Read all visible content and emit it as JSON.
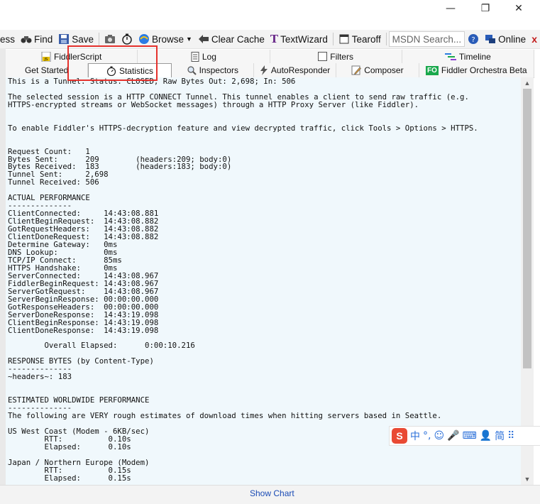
{
  "window": {
    "minimize": "—",
    "restore": "❐",
    "close": "✕"
  },
  "toolbar": {
    "partial_left": "ess",
    "find": "Find",
    "save": "Save",
    "browse": "Browse",
    "clear_cache": "Clear Cache",
    "textwizard": "TextWizard",
    "tearoff": "Tearoff",
    "search_placeholder": "MSDN Search...",
    "online": "Online",
    "close_x": "x"
  },
  "tabs_row1": [
    {
      "label": "FiddlerScript",
      "icon": "js-file-icon"
    },
    {
      "label": "Log",
      "icon": "document-icon"
    },
    {
      "label": "Filters",
      "icon": "checkbox-icon"
    },
    {
      "label": "Timeline",
      "icon": "timeline-icon"
    }
  ],
  "tabs_row2": [
    {
      "label": "Get Started",
      "icon": ""
    },
    {
      "label": "Statistics",
      "icon": "stopwatch-icon",
      "active": true
    },
    {
      "label": "Inspectors",
      "icon": "magnifier-icon"
    },
    {
      "label": "AutoResponder",
      "icon": "lightning-icon"
    },
    {
      "label": "Composer",
      "icon": "pencil-icon"
    },
    {
      "label": "Fiddler Orchestra Beta",
      "icon": "fo-badge-icon",
      "badge": "FO"
    }
  ],
  "statistics": {
    "lines": [
      "This is a Tunnel. Status: CLOSED, Raw Bytes Out: 2,698; In: 506",
      "",
      "The selected session is a HTTP CONNECT Tunnel. This tunnel enables a client to send raw traffic (e.g.",
      "HTTPS-encrypted streams or WebSocket messages) through a HTTP Proxy Server (like Fiddler).",
      "",
      "",
      "To enable Fiddler's HTTPS-decryption feature and view decrypted traffic, click Tools > Options > HTTPS.",
      "",
      "",
      "Request Count:   1",
      "Bytes Sent:      209        (headers:209; body:0)",
      "Bytes Received:  183        (headers:183; body:0)",
      "Tunnel Sent:     2,698",
      "Tunnel Received: 506",
      "",
      "ACTUAL PERFORMANCE",
      "--------------",
      "ClientConnected:     14:43:08.881",
      "ClientBeginRequest:  14:43:08.882",
      "GotRequestHeaders:   14:43:08.882",
      "ClientDoneRequest:   14:43:08.882",
      "Determine Gateway:   0ms",
      "DNS Lookup:          0ms",
      "TCP/IP Connect:      85ms",
      "HTTPS Handshake:     0ms",
      "ServerConnected:     14:43:08.967",
      "FiddlerBeginRequest: 14:43:08.967",
      "ServerGotRequest:    14:43:08.967",
      "ServerBeginResponse: 00:00:00.000",
      "GotResponseHeaders:  00:00:00.000",
      "ServerDoneResponse:  14:43:19.098",
      "ClientBeginResponse: 14:43:19.098",
      "ClientDoneResponse:  14:43:19.098",
      "",
      "        Overall Elapsed:      0:00:10.216",
      "",
      "RESPONSE BYTES (by Content-Type)",
      "--------------",
      "~headers~: 183",
      "",
      "",
      "ESTIMATED WORLDWIDE PERFORMANCE",
      "--------------",
      "The following are VERY rough estimates of download times when hitting servers based in Seattle.",
      "",
      "US West Coast (Modem - 6KB/sec)",
      "        RTT:          0.10s",
      "        Elapsed:      0.10s",
      "",
      "Japan / Northern Europe (Modem)",
      "        RTT:          0.15s",
      "        Elapsed:      0.15s"
    ]
  },
  "bottom": {
    "show_chart": "Show Chart"
  },
  "ime_toolbar": {
    "logo": "S",
    "mode": "中",
    "punct": "°,",
    "emoji": "☺",
    "voice": "🎤",
    "keyboard": "⌨",
    "user": "👤",
    "simplified": "简",
    "menu": "⠿"
  },
  "colors": {
    "accent_red_box": "#e5322d",
    "content_bg": "#f0f8fc",
    "link": "#1a4bb5"
  }
}
